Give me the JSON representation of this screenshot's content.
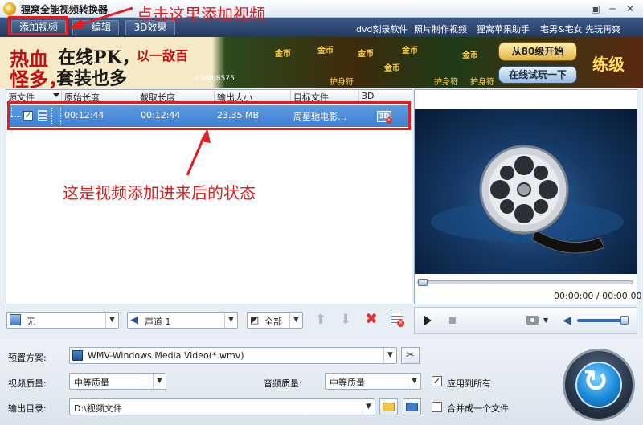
{
  "window": {
    "title": "狸窝全能视频转换器",
    "min_glyph": "▣",
    "max_glyph": "─",
    "close_glyph": "✕"
  },
  "toolbar": {
    "add_video": "添加视频",
    "edit": "编辑",
    "effect_3d": "3D效果",
    "links": [
      "dvd刻录软件",
      "照片制作视频",
      "狸窝苹果助手",
      "宅男&宅女 先玩再爽"
    ]
  },
  "banner": {
    "line1_red": "热血",
    "line1_black": "在线PK，",
    "line1_tail": "以一敌百",
    "line2_red": "怪多，",
    "line2_black": "套装也多",
    "counter": "6588/8575",
    "coin": "金币",
    "guard": "护身符",
    "start": "从80级开始",
    "play": "在线试玩一下",
    "level": "练级"
  },
  "file_list": {
    "columns": [
      "源文件",
      "原始长度",
      "截取长度",
      "输出大小",
      "目标文件",
      "3D"
    ],
    "rows": [
      {
        "checked": true,
        "original_length": "00:12:44",
        "clip_length": "00:12:44",
        "output_size": "23.35 MB",
        "target_file": "周星驰电影…",
        "badge_3d": "3D"
      }
    ]
  },
  "annotations": {
    "top": "点击这里添加视频",
    "middle": "这是视频添加进来后的状态"
  },
  "list_controls": {
    "subtitle": "无",
    "audio_track": "声道 1",
    "range": "全部"
  },
  "player": {
    "time": "00:00:00 / 00:00:00"
  },
  "settings": {
    "preset_label": "预置方案:",
    "preset_value": "WMV-Windows Media Video(*.wmv)",
    "video_quality_label": "视频质量:",
    "video_quality_value": "中等质量",
    "audio_quality_label": "音频质量:",
    "audio_quality_value": "中等质量",
    "apply_all_label": "应用到所有",
    "apply_all_checked": true,
    "output_dir_label": "输出目录:",
    "output_dir_value": "D:\\视频文件",
    "merge_label": "合并成一个文件",
    "merge_checked": false
  }
}
